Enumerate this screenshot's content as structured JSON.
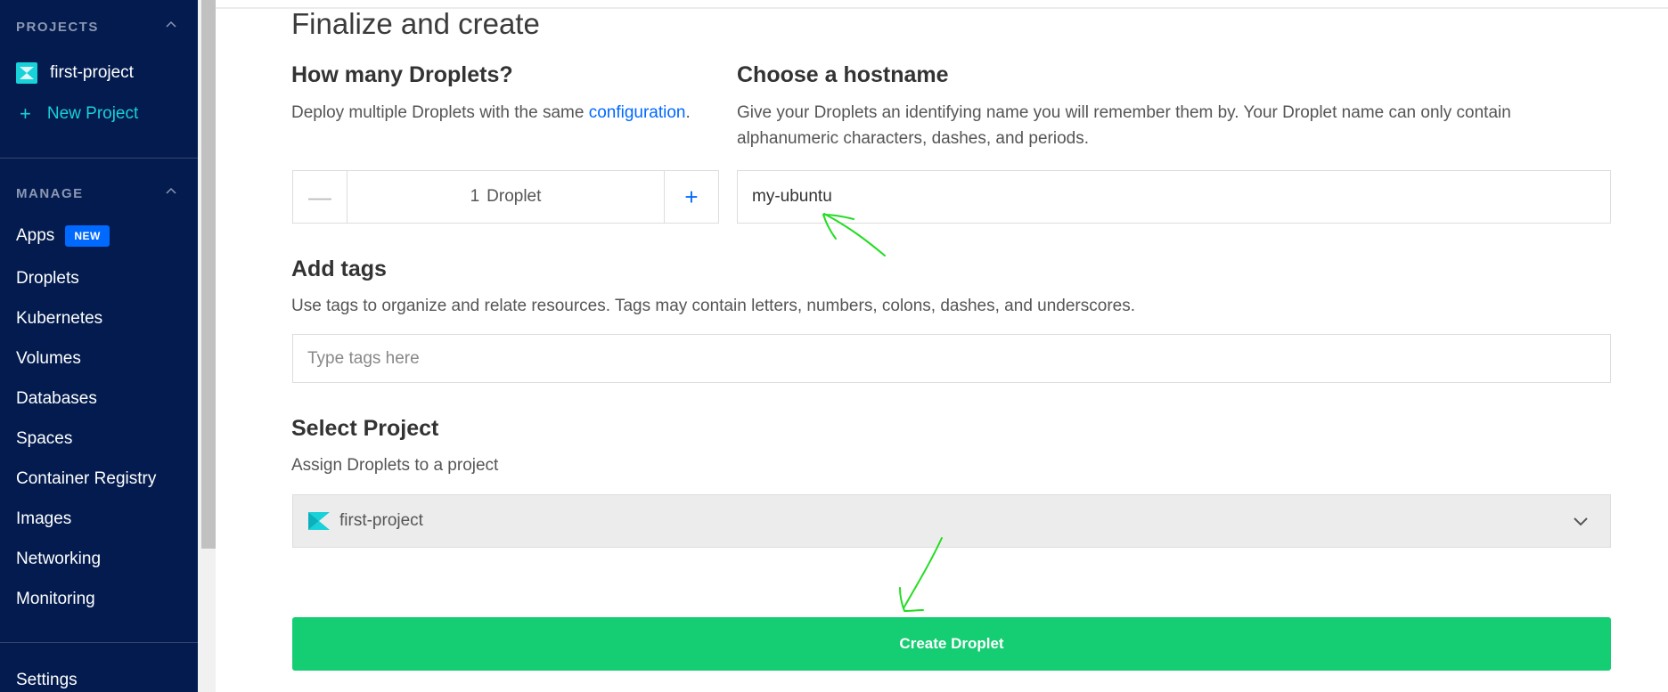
{
  "sidebar": {
    "projects_heading": "PROJECTS",
    "project_name": "first-project",
    "new_project": "New Project",
    "manage_heading": "MANAGE",
    "items": [
      {
        "label": "Apps",
        "badge": "NEW"
      },
      {
        "label": "Droplets"
      },
      {
        "label": "Kubernetes"
      },
      {
        "label": "Volumes"
      },
      {
        "label": "Databases"
      },
      {
        "label": "Spaces"
      },
      {
        "label": "Container Registry"
      },
      {
        "label": "Images"
      },
      {
        "label": "Networking"
      },
      {
        "label": "Monitoring"
      }
    ],
    "settings": "Settings"
  },
  "main": {
    "title": "Finalize and create",
    "droplets": {
      "heading": "How many Droplets?",
      "desc_prefix": "Deploy multiple Droplets with the same ",
      "desc_link": "configuration",
      "desc_suffix": ".",
      "count": "1",
      "unit": "Droplet",
      "minus": "—",
      "plus": "+"
    },
    "hostname": {
      "heading": "Choose a hostname",
      "desc_line1": "Give your Droplets an identifying name you will remember them by. Your Droplet name can only contain",
      "desc_line2": "alphanumeric characters, dashes, and periods.",
      "value": "my-ubuntu"
    },
    "tags": {
      "heading": "Add tags",
      "desc": "Use tags to organize and relate resources. Tags may contain letters, numbers, colons, dashes, and underscores.",
      "placeholder": "Type tags here"
    },
    "project": {
      "heading": "Select Project",
      "desc": "Assign Droplets to a project",
      "selected": "first-project"
    },
    "create_button": "Create Droplet"
  },
  "colors": {
    "sidebar_bg": "#031b4e",
    "accent_blue": "#0069ff",
    "teal": "#19d1d8",
    "create_green": "#15cd72",
    "annotation_green": "#22dd22"
  }
}
